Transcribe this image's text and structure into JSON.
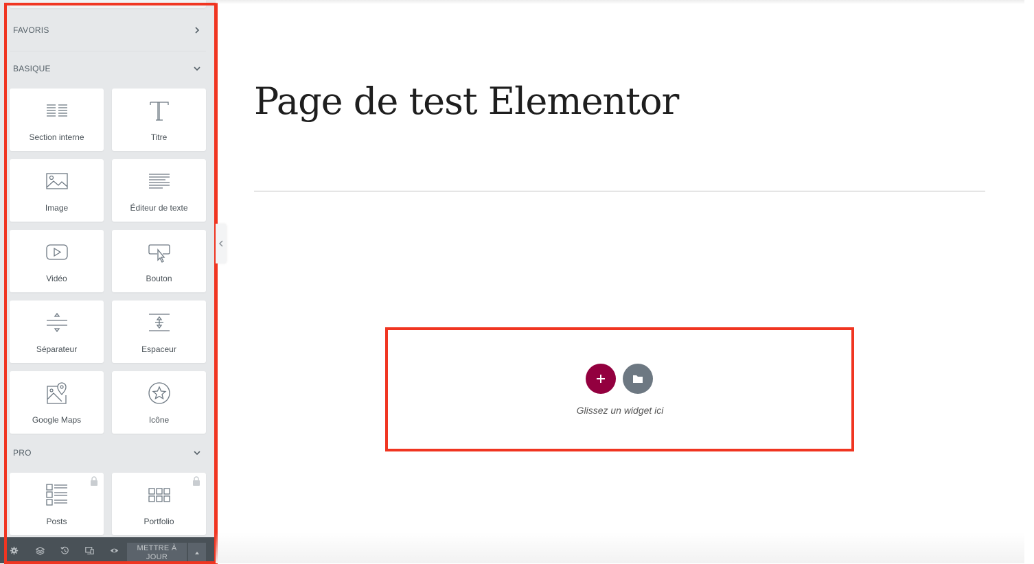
{
  "panel": {
    "categories": [
      {
        "label": "FAVORIS",
        "state": "collapsed"
      },
      {
        "label": "BASIQUE",
        "state": "expanded"
      },
      {
        "label": "PRO",
        "state": "expanded"
      }
    ],
    "basic_widgets": [
      {
        "label": "Section interne",
        "icon": "inner-section-icon"
      },
      {
        "label": "Titre",
        "icon": "heading-icon"
      },
      {
        "label": "Image",
        "icon": "image-icon"
      },
      {
        "label": "Éditeur de texte",
        "icon": "text-editor-icon"
      },
      {
        "label": "Vidéo",
        "icon": "video-icon"
      },
      {
        "label": "Bouton",
        "icon": "button-icon"
      },
      {
        "label": "Séparateur",
        "icon": "divider-icon"
      },
      {
        "label": "Espaceur",
        "icon": "spacer-icon"
      },
      {
        "label": "Google Maps",
        "icon": "google-maps-icon"
      },
      {
        "label": "Icône",
        "icon": "star-icon"
      }
    ],
    "pro_widgets": [
      {
        "label": "Posts",
        "icon": "posts-icon",
        "locked": true
      },
      {
        "label": "Portfolio",
        "icon": "portfolio-icon",
        "locked": true
      }
    ],
    "footer": {
      "icons": [
        "settings-icon",
        "navigator-layers-icon",
        "history-icon",
        "responsive-mode-icon",
        "preview-eye-icon"
      ],
      "update_label_line1": "METTRE À",
      "update_label_line2": "JOUR"
    }
  },
  "page": {
    "title": "Page de test Elementor"
  },
  "drop_zone": {
    "hint": "Glissez un widget ici",
    "add_icon": "plus-icon",
    "template_icon": "folder-icon"
  },
  "colors": {
    "panel_bg": "#e6e8ea",
    "footer_bg": "#495157",
    "add_button": "#93003f",
    "template_button": "#6d7882",
    "highlight": "#f03521"
  }
}
